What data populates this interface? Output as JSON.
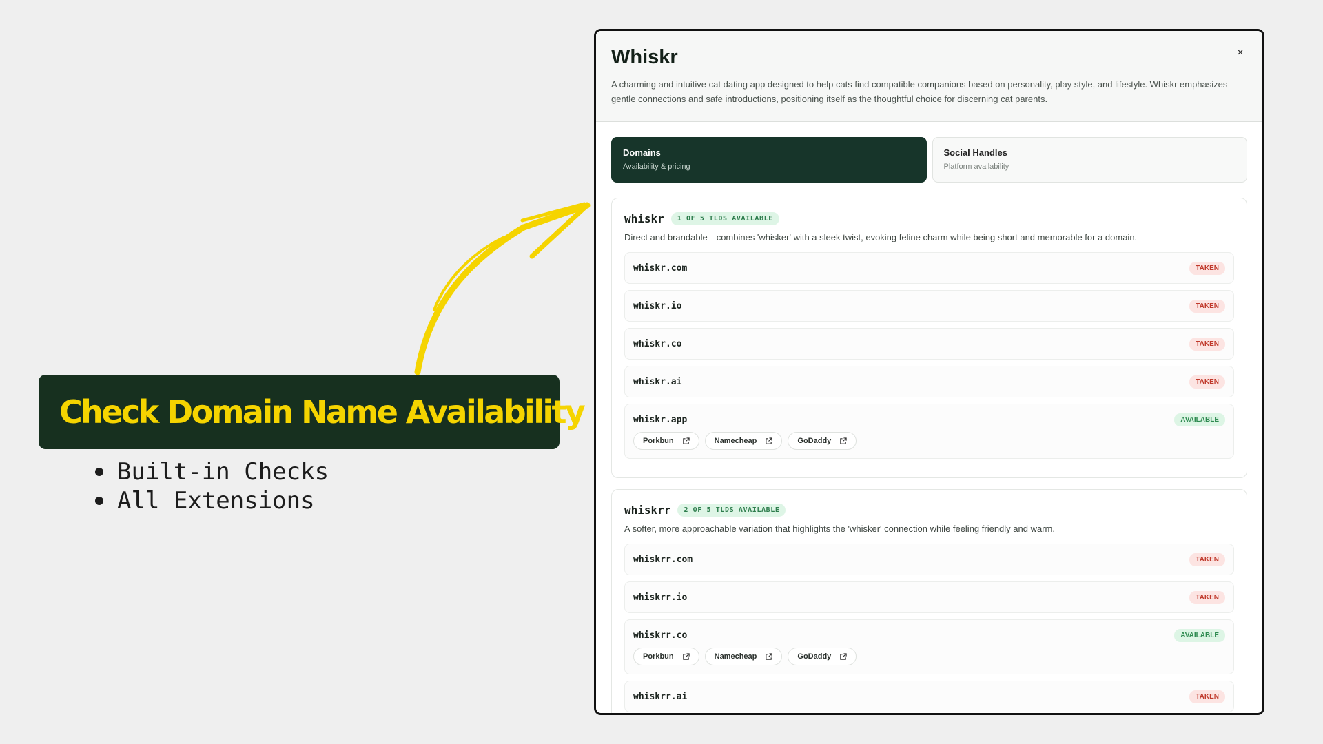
{
  "promo": {
    "title": "Check Domain Name Availability",
    "bullets": [
      "Built-in Checks",
      "All Extensions"
    ]
  },
  "modal": {
    "title": "Whiskr",
    "description": "A charming and intuitive cat dating app designed to help cats find compatible companions based on personality, play style, and lifestyle. Whiskr emphasizes gentle connections and safe introductions, positioning itself as the thoughtful choice for discerning cat parents.",
    "close_label": "×",
    "tabs": [
      {
        "label": "Domains",
        "sub": "Availability & pricing",
        "active": true
      },
      {
        "label": "Social Handles",
        "sub": "Platform availability",
        "active": false
      }
    ],
    "groups": [
      {
        "name": "whiskr",
        "badge": "1 OF 5 TLDS AVAILABLE",
        "description": "Direct and brandable—combines 'whisker' with a sleek twist, evoking feline charm while being short and memorable for a domain.",
        "domains": [
          {
            "name": "whiskr.com",
            "status": "TAKEN"
          },
          {
            "name": "whiskr.io",
            "status": "TAKEN"
          },
          {
            "name": "whiskr.co",
            "status": "TAKEN"
          },
          {
            "name": "whiskr.ai",
            "status": "TAKEN"
          },
          {
            "name": "whiskr.app",
            "status": "AVAILABLE",
            "registrars": [
              "Porkbun",
              "Namecheap",
              "GoDaddy"
            ]
          }
        ]
      },
      {
        "name": "whiskrr",
        "badge": "2 OF 5 TLDS AVAILABLE",
        "description": "A softer, more approachable variation that highlights the 'whisker' connection while feeling friendly and warm.",
        "domains": [
          {
            "name": "whiskrr.com",
            "status": "TAKEN"
          },
          {
            "name": "whiskrr.io",
            "status": "TAKEN"
          },
          {
            "name": "whiskrr.co",
            "status": "AVAILABLE",
            "registrars": [
              "Porkbun",
              "Namecheap",
              "GoDaddy"
            ]
          },
          {
            "name": "whiskrr.ai",
            "status": "TAKEN"
          }
        ]
      }
    ]
  },
  "colors": {
    "brand_dark": "#17301f",
    "promo_yellow": "#f5d400",
    "taken": "#c0392b",
    "available": "#2e8a50"
  }
}
